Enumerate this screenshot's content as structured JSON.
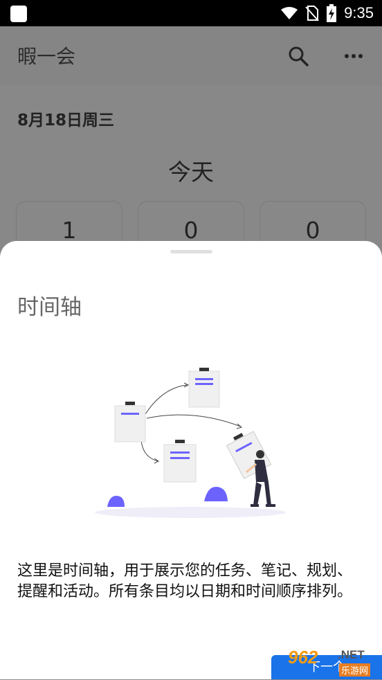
{
  "status_bar": {
    "time": "9:35",
    "icons": [
      "wifi-icon",
      "no-sim-icon",
      "battery-charging-icon"
    ]
  },
  "app_bar": {
    "title": "暇一会",
    "search_icon": "search-icon",
    "more_icon": "more-vertical-icon"
  },
  "main": {
    "date": "8月18日周三",
    "today_label": "今天",
    "cards": [
      {
        "value": "1"
      },
      {
        "value": "0"
      },
      {
        "value": "0"
      }
    ]
  },
  "sheet": {
    "title": "时间轴",
    "illustration": "timeline-illustration",
    "description": "这里是时间轴，用于展示您的任务、笔记、规划、提醒和活动。所有条目均以日期和时间顺序排列。",
    "next_button": "下一个"
  },
  "watermark": {
    "main": "962",
    "net": ".NET",
    "sub": "乐游网"
  },
  "colors": {
    "accent": "#6c63ff",
    "button": "#1a73e8",
    "overlay": "#888888"
  }
}
